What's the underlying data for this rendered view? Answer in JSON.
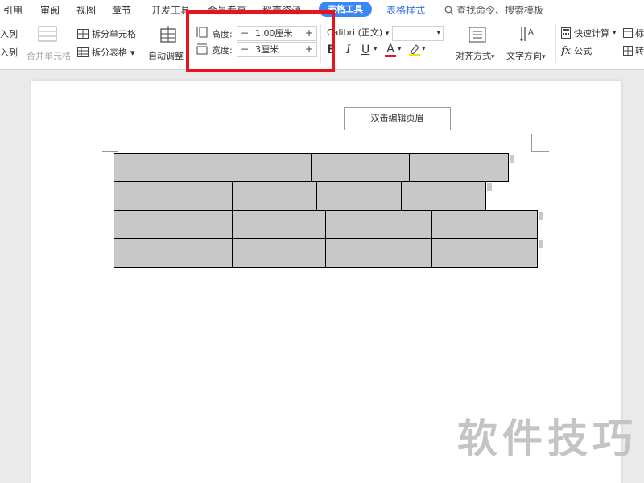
{
  "menu": {
    "items": [
      "引用",
      "审阅",
      "视图",
      "章节",
      "开发工具",
      "会员专享",
      "稻壳资源"
    ],
    "active_tab": "表格工具",
    "style_tab": "表格样式",
    "search": "查找命令、搜索模板"
  },
  "ribbon": {
    "insert_col_a": "入列",
    "insert_col_b": "入列",
    "merge_cells": "合并单元格",
    "split_cells": "拆分单元格",
    "split_table": "拆分表格",
    "auto_fit": "自动调整",
    "height_label": "高度:",
    "height_value": "1.00厘米",
    "width_label": "宽度:",
    "width_value": "3厘米",
    "minus": "−",
    "plus": "+",
    "font_name": "Calibri (正文)",
    "font_size": "",
    "bold": "B",
    "italic": "I",
    "underline": "U",
    "font_color": "A",
    "align": "对齐方式",
    "text_dir": "文字方向",
    "quick_calc": "快速计算",
    "formula": "公式",
    "title_row": "标",
    "convert": "转"
  },
  "document": {
    "header_button": "双击编辑页眉"
  },
  "watermark": "软件技巧",
  "colors": {
    "accent": "#3b86f5",
    "highlight": "#e8141b",
    "cell_fill": "#c8c8c8"
  }
}
